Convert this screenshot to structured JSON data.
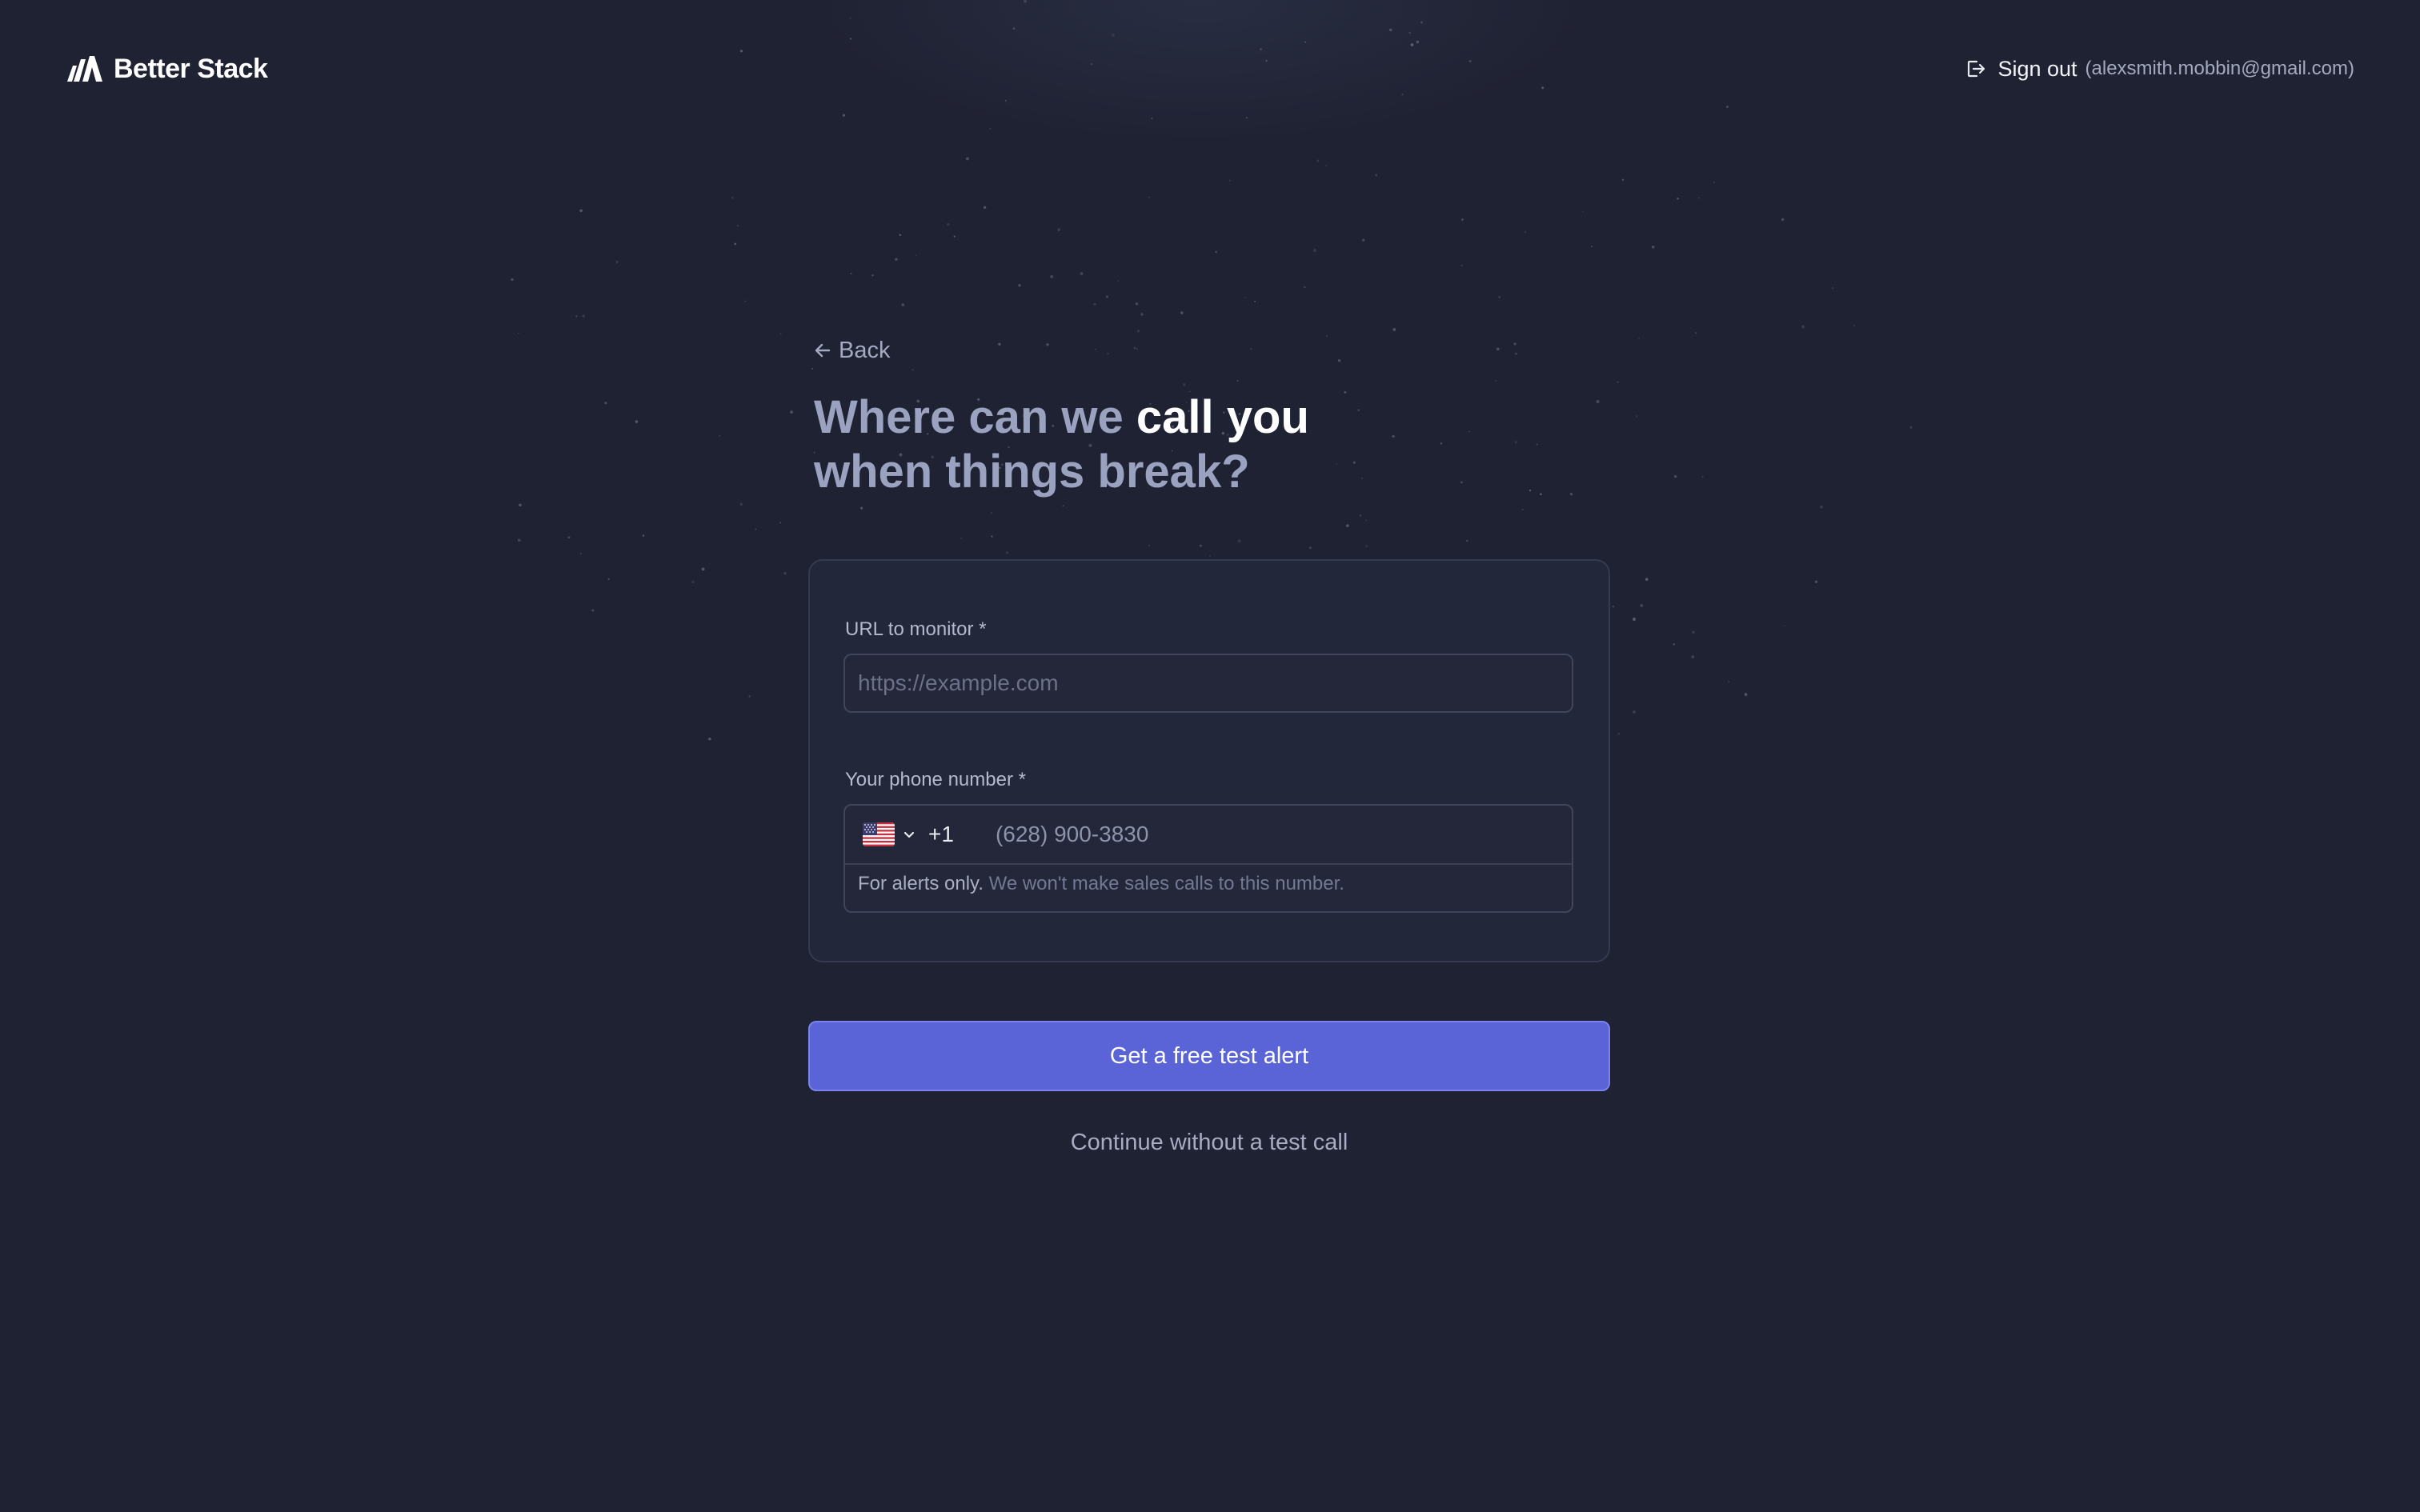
{
  "header": {
    "brand_name": "Better Stack",
    "logo_icon": "better-stack-logo-icon",
    "signout_icon": "sign-out-icon",
    "signout_label": "Sign out",
    "signout_email": "(alexsmith.mobbin@gmail.com)"
  },
  "nav": {
    "back_icon": "arrow-left-icon",
    "back_label": "Back"
  },
  "heading": {
    "part1": "Where can we ",
    "highlight": "call you",
    "part2": "when things break?"
  },
  "form": {
    "url": {
      "label": "URL to monitor *",
      "placeholder": "https://example.com",
      "value": ""
    },
    "phone": {
      "label": "Your phone number *",
      "country_flag": "us-flag-icon",
      "dropdown_icon": "chevron-down-icon",
      "dial_code": "+1",
      "placeholder": "(628) 900-3830",
      "value": "",
      "hint_strong": "For alerts only.",
      "hint_muted": " We won't make sales calls to this number."
    }
  },
  "actions": {
    "primary_label": "Get a free test alert",
    "secondary_label": "Continue without a test call"
  },
  "colors": {
    "background": "#1f2232",
    "card": "#23273a",
    "accent": "#5b64d6",
    "heading_muted": "#9aa2c0",
    "heading_highlight": "#ffffff"
  }
}
